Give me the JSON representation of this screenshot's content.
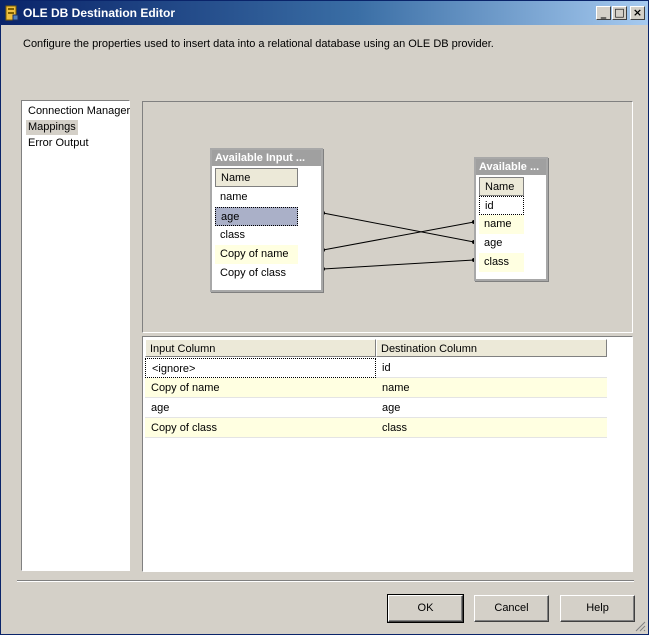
{
  "window": {
    "title": "OLE DB Destination Editor"
  },
  "titlebar_buttons": {
    "minimize": "_",
    "maximize": "□",
    "close": "×"
  },
  "description": "Configure the properties used to insert data into a relational database using an OLE DB provider.",
  "sidebar": {
    "items": [
      {
        "label": "Connection Manager"
      },
      {
        "label": "Mappings"
      },
      {
        "label": "Error Output"
      }
    ]
  },
  "diagram": {
    "input_box": {
      "title": "Available Input ...",
      "header": "Name",
      "rows": [
        "name",
        "age",
        "class",
        "Copy of name",
        "Copy of class"
      ]
    },
    "dest_box": {
      "title": "Available ...",
      "header": "Name",
      "rows": [
        "id",
        "name",
        "age",
        "class"
      ]
    }
  },
  "grid": {
    "headers": [
      "Input Column",
      "Destination Column"
    ],
    "rows": [
      {
        "input": "<ignore>",
        "dest": "id"
      },
      {
        "input": "Copy of name",
        "dest": "name"
      },
      {
        "input": "age",
        "dest": "age"
      },
      {
        "input": "Copy of class",
        "dest": "class"
      }
    ]
  },
  "buttons": {
    "ok": "OK",
    "cancel": "Cancel",
    "help": "Help"
  },
  "colors": {
    "title_start": "#0a246a",
    "title_end": "#a6caf0",
    "highlight": "#ffffe1",
    "face": "#d4d0c8"
  },
  "icons": [
    "app-icon",
    "resize-grip-icon"
  ]
}
